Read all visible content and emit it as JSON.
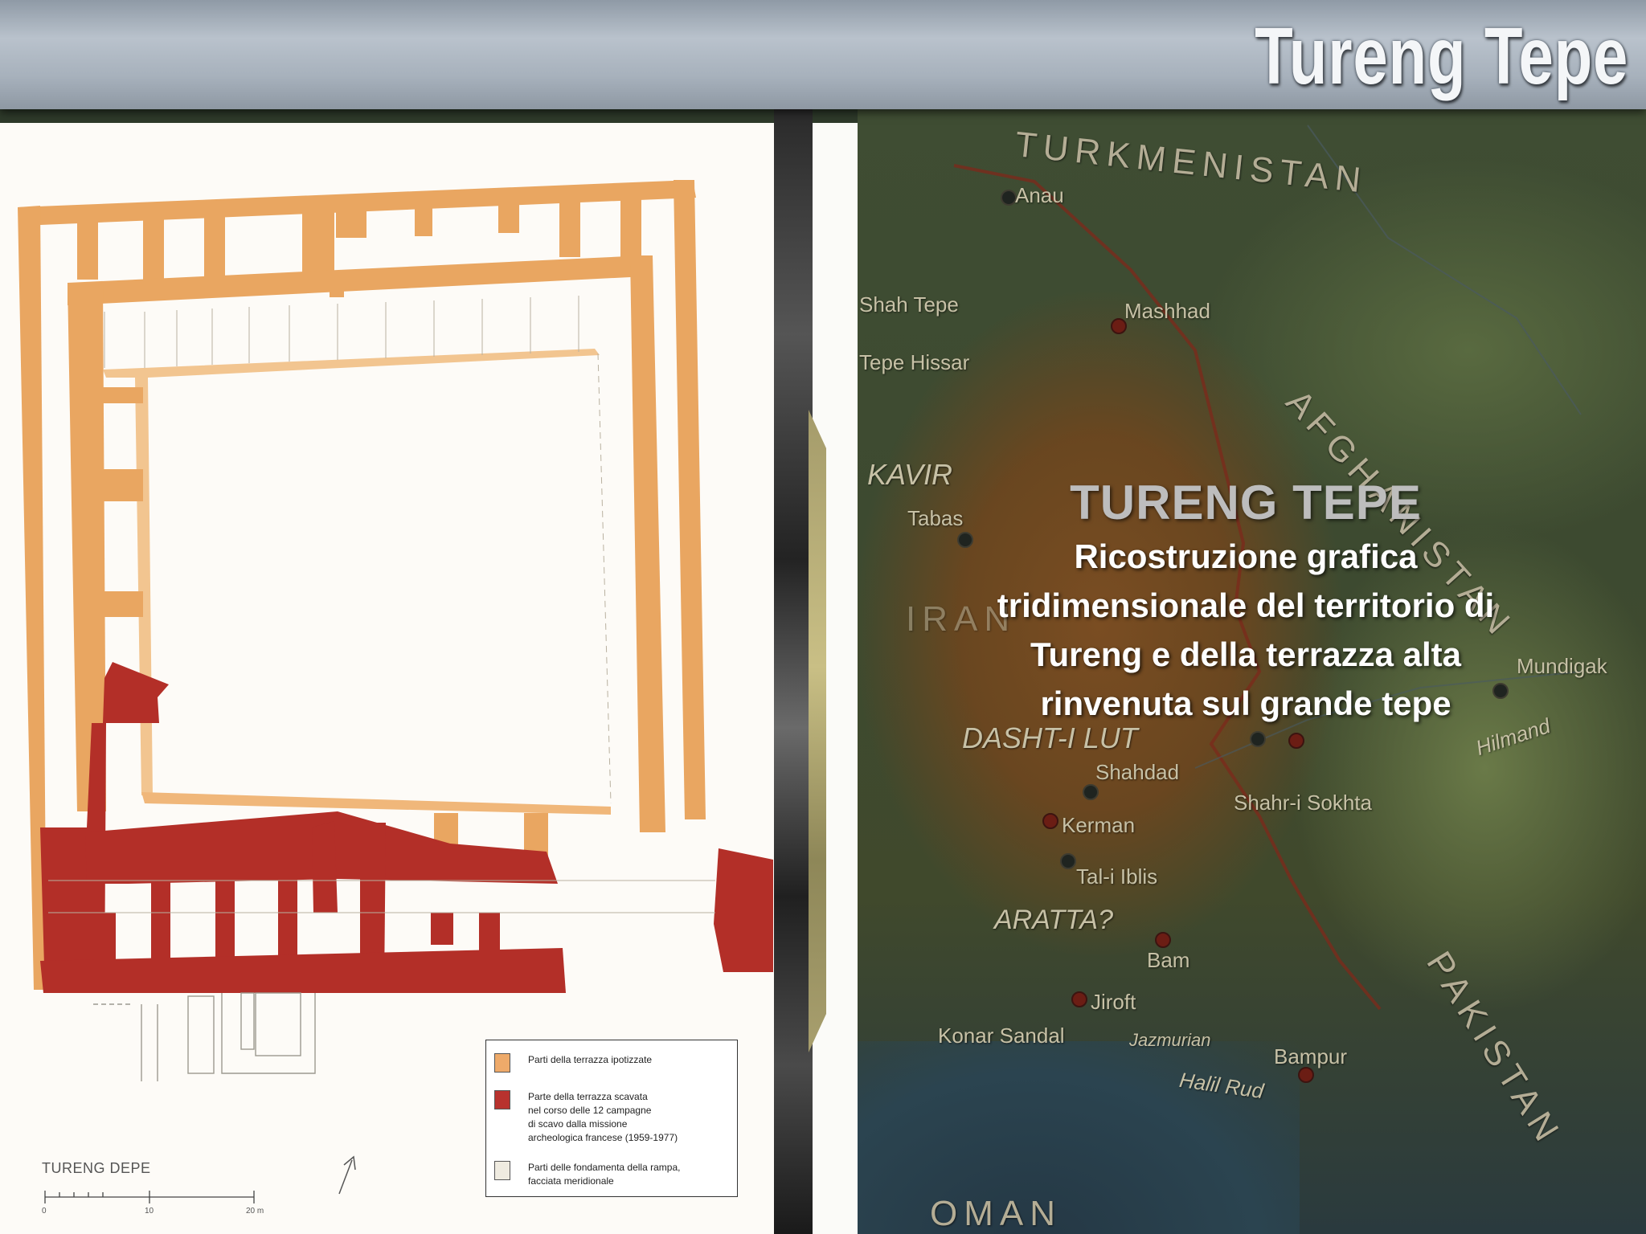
{
  "header": {
    "title": "Tureng Tepe"
  },
  "overlay": {
    "title": "TURENG TEPE",
    "subtitle_lines": [
      "Ricostruzione grafica",
      "tridimensionale del territorio di",
      "Tureng e della terrazza alta",
      "rinvenuta sul grande tepe"
    ]
  },
  "map": {
    "countries": [
      "TURKMENISTAN",
      "AFGHANISTAN",
      "PAKISTAN",
      "OMAN"
    ],
    "places": [
      "Anau",
      "Mashhad",
      "Shah Tepe",
      "Tepe Hissar",
      "Tabas",
      "Shahdad",
      "Kerman",
      "Shahr-i Sokhta",
      "Tal-i Iblis",
      "Bam",
      "Jiroft",
      "Konar Sandal",
      "Bampur",
      "Mundigak"
    ],
    "regions": [
      "KAVIR",
      "DASHT-I LUT",
      "ARATTA?",
      "IRAN"
    ],
    "rivers": [
      "Hilmand",
      "Halil Rud",
      "Jazmurian"
    ],
    "colors": {
      "highland": "#7a4d22",
      "lowland": "#3f4d33",
      "sea": "#2b4450"
    }
  },
  "plan": {
    "label": "TURENG DEPE",
    "scale": {
      "start": "0",
      "mid": "10",
      "end": "20 m"
    },
    "legend": [
      {
        "color": "#eeaa6a",
        "text": "Parti della terrazza ipotizzate"
      },
      {
        "color": "#b8322e",
        "text": "Parte della terrazza scavata\nnel corso delle 12 campagne\ndi scavo dalla missione\narcheologica francese (1959-1977)"
      },
      {
        "color": "#efebe0",
        "text": "Parti delle fondamenta della rampa,\nfacciata meridionale"
      }
    ],
    "colors": {
      "hypothesized": "#e9a661",
      "excavated": "#b32f28",
      "foundation": "#efebe0"
    }
  }
}
